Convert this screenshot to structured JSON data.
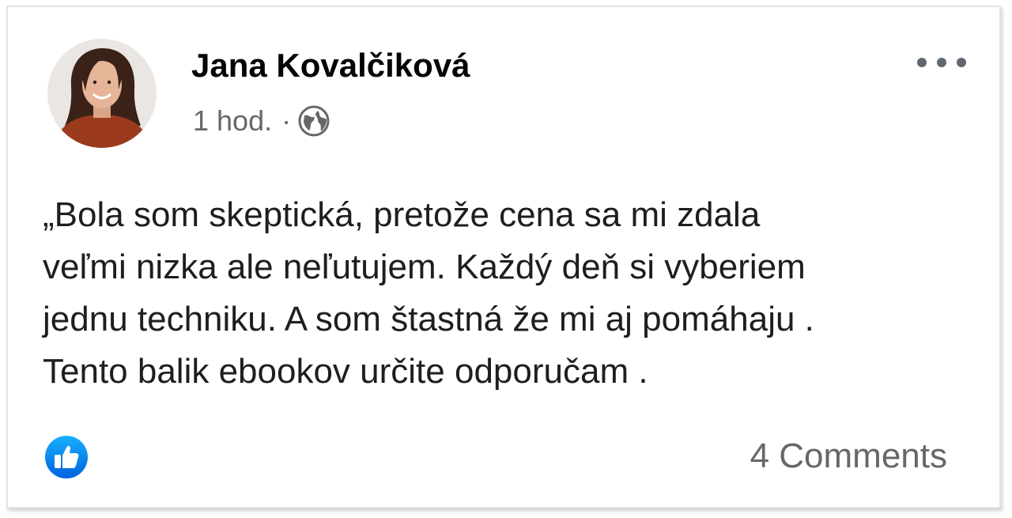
{
  "post": {
    "author_name": "Jana Kovalčiková",
    "time": "1 hod.",
    "separator": "·",
    "audience_icon": "globe-icon",
    "more_icon": "more-options-icon",
    "text": "„Bola som skeptická, pretože cena sa mi zdala\nveľmi nizka ale neľutujem. Každý deň si vyberiem\njednu techniku. A som štastná že mi aj pomáhaju .\nTento balik ebookov určite odporučam .",
    "reaction_icon": "like-icon",
    "comments_label": "4 Comments"
  },
  "colors": {
    "like_blue": "#1877f2",
    "secondary_text": "#65676b",
    "primary_text": "#050505"
  }
}
